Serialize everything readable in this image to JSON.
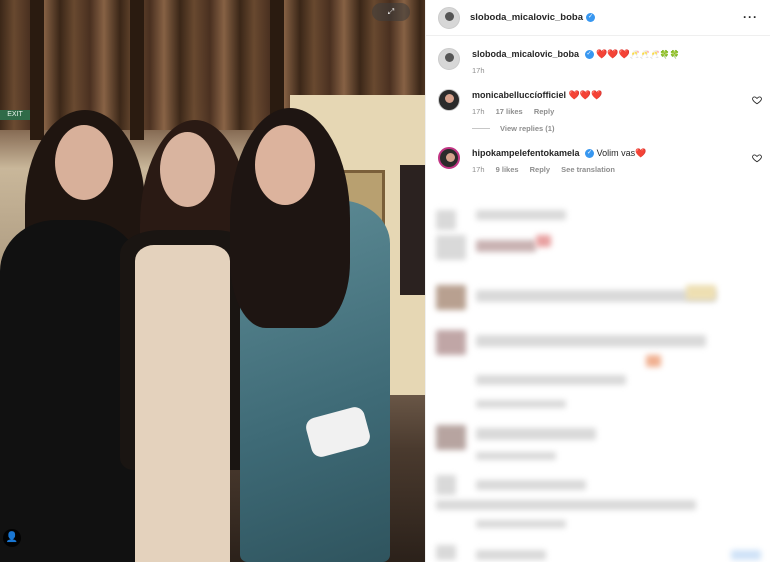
{
  "photo": {
    "exit_sign": "EXIT",
    "user_tag_icon": "person-icon",
    "top_badge_icon": "expand-icon"
  },
  "post": {
    "author": "sloboda_micalovic_boba",
    "more_icon": "more-horizontal-icon"
  },
  "comments": [
    {
      "username": "sloboda_micalovic_boba",
      "verified": true,
      "text": "❤️❤️❤️",
      "extra": "🥂🥂🥂🍀🍀",
      "time": "17h"
    },
    {
      "username": "monicabelluccíofficiel",
      "verified": false,
      "text": "❤️❤️❤️",
      "time": "17h",
      "likes": "17 likes",
      "reply": "Reply",
      "view_replies": "View replies (1)"
    },
    {
      "username": "hipokampelefentokamela",
      "verified": true,
      "text": "Volim vas❤️",
      "time": "17h",
      "likes": "9 likes",
      "reply": "Reply",
      "translation": "See translation"
    }
  ],
  "colors": {
    "verified": "#3897f0",
    "heart": "#e0245e",
    "muted": "#8e8e8e"
  }
}
